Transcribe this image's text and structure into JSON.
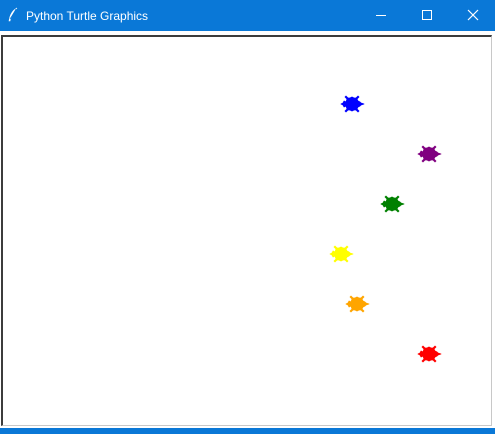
{
  "window": {
    "title": "Python Turtle Graphics",
    "accent_color": "#0a78d7",
    "app_icon": "feather-icon",
    "controls": [
      "minimize-icon",
      "maximize-icon",
      "close-icon"
    ]
  },
  "canvas": {
    "background": "#ffffff",
    "turtles": [
      {
        "color": "#0000ff"
      },
      {
        "color": "#800080"
      },
      {
        "color": "#008000"
      },
      {
        "color": "#ffff00"
      },
      {
        "color": "#ffa500"
      },
      {
        "color": "#ff0000"
      }
    ]
  }
}
